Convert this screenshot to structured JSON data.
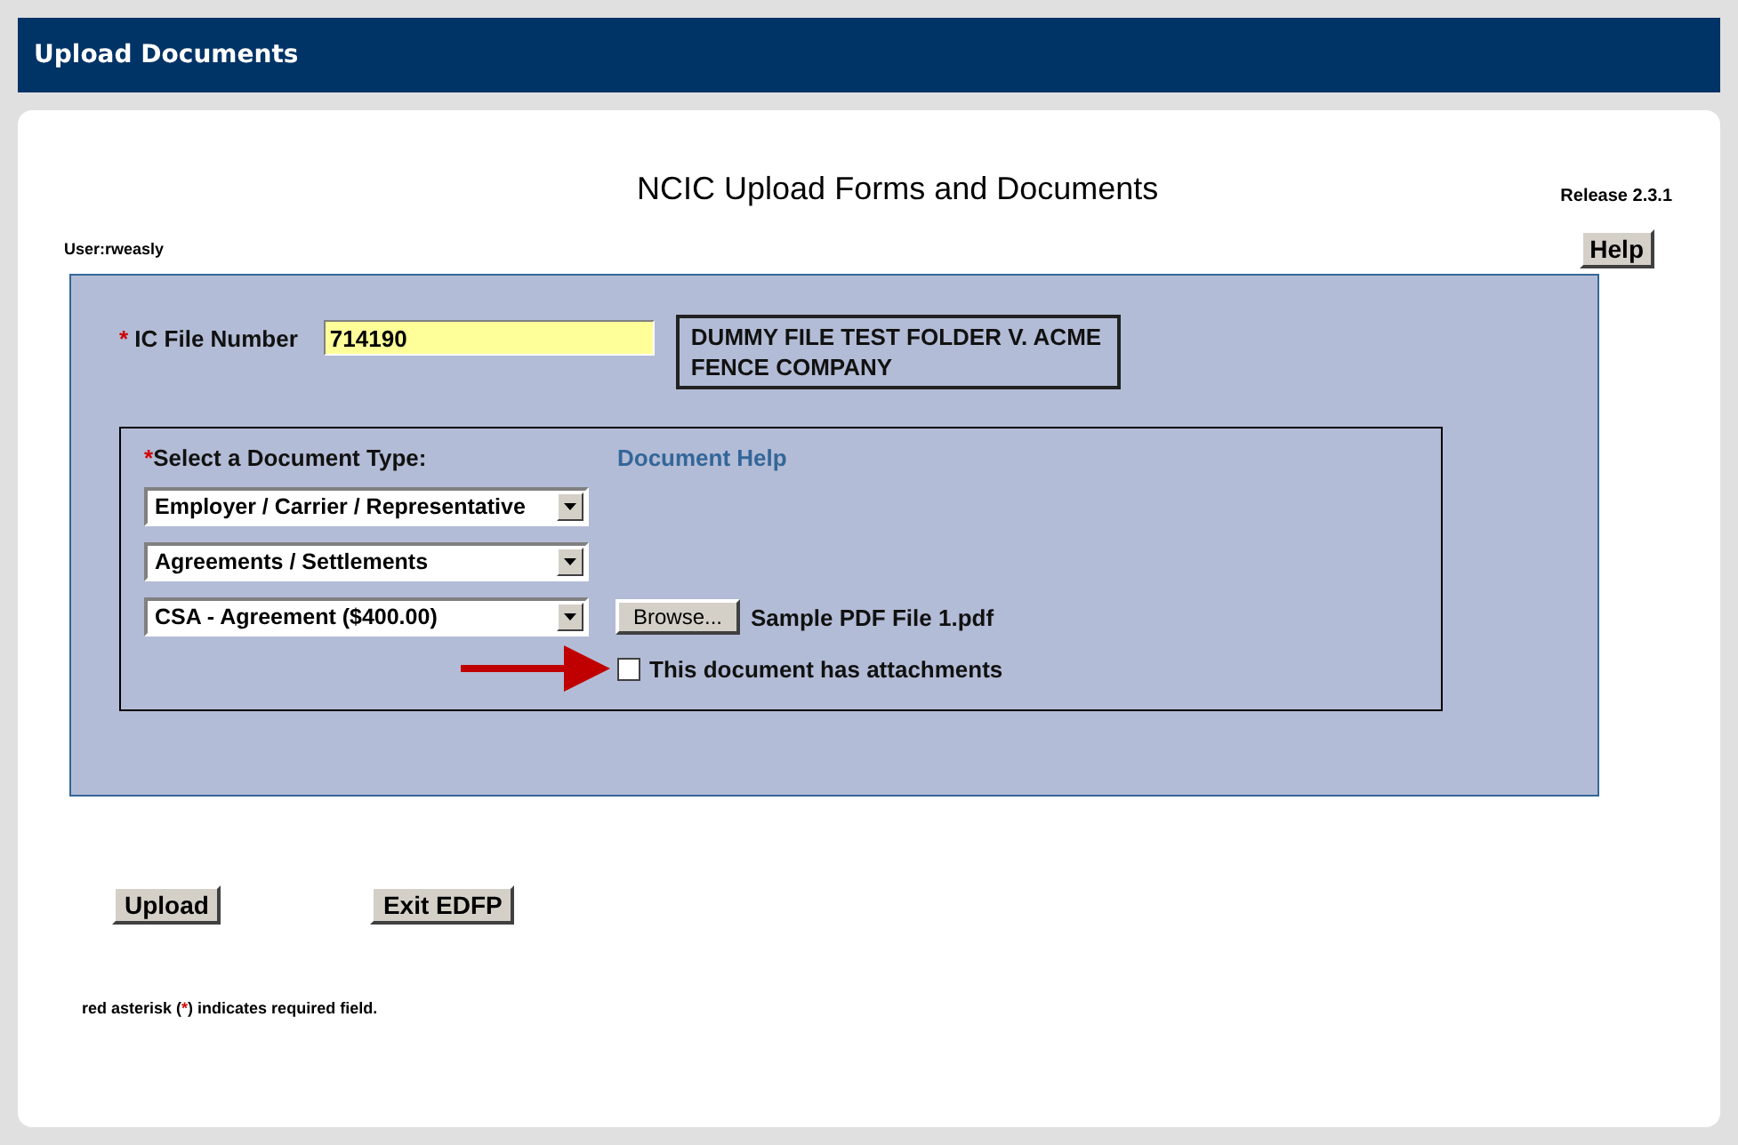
{
  "header": {
    "title": "Upload Documents"
  },
  "page": {
    "title": "NCIC Upload Forms and Documents",
    "release": "Release 2.3.1",
    "user": "User:rweasly",
    "help_button": "Help"
  },
  "file_number": {
    "required_mark": "*",
    "label": "IC File Number",
    "value": "714190",
    "case_name": "DUMMY FILE TEST FOLDER V. ACME FENCE COMPANY"
  },
  "document": {
    "required_mark": "*",
    "label": "Select a Document Type:",
    "help_link": "Document Help",
    "selects": [
      {
        "value": "Employer / Carrier / Representative"
      },
      {
        "value": "Agreements / Settlements"
      },
      {
        "value": "CSA - Agreement ($400.00)"
      }
    ],
    "browse_button": "Browse...",
    "file_name": "Sample PDF File 1.pdf",
    "attachments": {
      "label": "This document has attachments",
      "checked": false
    }
  },
  "buttons": [
    {
      "label": "Upload"
    },
    {
      "label": "Exit EDFP"
    }
  ],
  "note": {
    "before": "red asterisk (",
    "mark": "*",
    "after": ") indicates required field."
  }
}
